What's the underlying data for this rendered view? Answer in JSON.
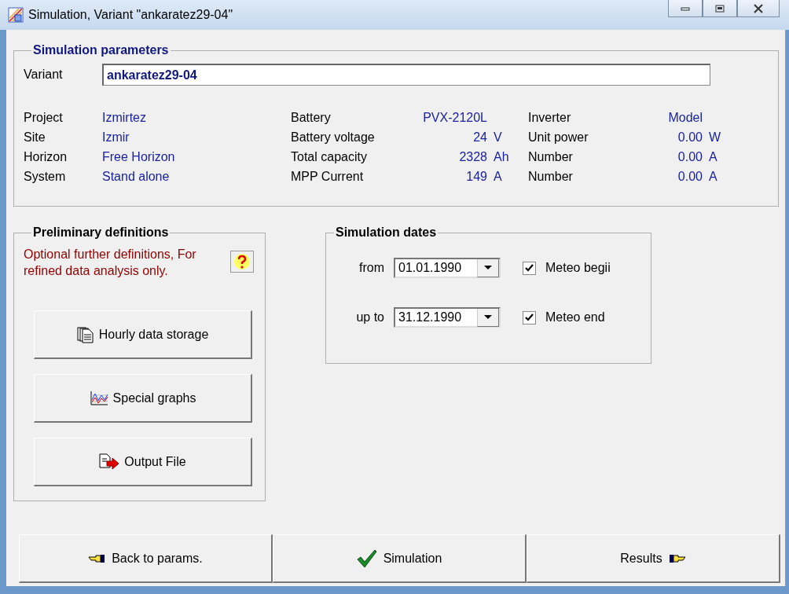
{
  "window": {
    "title": "Simulation, Variant  \"ankaratez29-04\""
  },
  "parameters": {
    "title": "Simulation parameters",
    "variant_label": "Variant",
    "variant_value": "ankaratez29-04",
    "columns": [
      [
        {
          "label": "Project",
          "value": "Izmirtez"
        },
        {
          "label": "Site",
          "value": "Izmir"
        },
        {
          "label": "Horizon",
          "value": "Free Horizon"
        },
        {
          "label": "System",
          "value": "Stand alone"
        }
      ],
      [
        {
          "label": "Battery",
          "value": "PVX-2120L"
        },
        {
          "label": "Battery voltage",
          "value": "24",
          "unit": "V"
        },
        {
          "label": "Total capacity",
          "value": "2328",
          "unit": "Ah"
        },
        {
          "label": "MPP Current",
          "value": "149",
          "unit": "A"
        }
      ],
      [
        {
          "label": "Inverter",
          "value": "Model"
        },
        {
          "label": "Unit power",
          "value": "0.00",
          "unit": "W"
        },
        {
          "label": "Number",
          "value": "0.00",
          "unit": "A"
        },
        {
          "label": "Number",
          "value": "0.00",
          "unit": "A"
        }
      ]
    ]
  },
  "preliminary": {
    "title": "Preliminary definitions",
    "note": "Optional further definitions, For refined data analysis only.",
    "buttons": [
      {
        "kind": "storage",
        "label": "Hourly data storage"
      },
      {
        "kind": "graphs",
        "label": "Special graphs"
      },
      {
        "kind": "output",
        "label": "Output File"
      }
    ]
  },
  "dates": {
    "title": "Simulation dates",
    "rows": [
      {
        "label": "from",
        "value": "01.01.1990",
        "check_label": "Meteo begii",
        "checked": true
      },
      {
        "label": "up to",
        "value": "31.12.1990",
        "check_label": "Meteo end",
        "checked": true
      }
    ]
  },
  "footer": [
    {
      "kind": "back",
      "label": "Back to params."
    },
    {
      "kind": "simulate",
      "label": "Simulation"
    },
    {
      "kind": "results",
      "label": "Results"
    }
  ]
}
